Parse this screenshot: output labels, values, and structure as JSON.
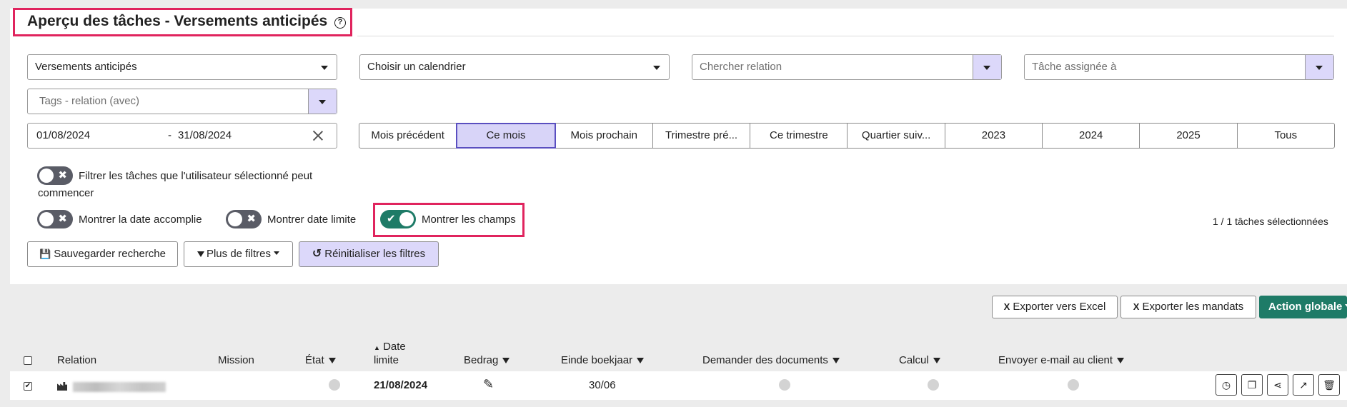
{
  "header": {
    "title": "Aperçu des tâches - Versements anticipés",
    "help_glyph": "?"
  },
  "filters": {
    "type_select": "Versements anticipés",
    "calendar_select": "Choisir un calendrier",
    "relation_search_placeholder": "Chercher relation",
    "assigned_placeholder": "Tâche assignée à",
    "tags_placeholder": "Tags - relation (avec)",
    "date_from": "01/08/2024",
    "date_separator": "-",
    "date_to": "31/08/2024"
  },
  "periods": [
    {
      "label": "Mois précédent",
      "active": false
    },
    {
      "label": "Ce mois",
      "active": true
    },
    {
      "label": "Mois prochain",
      "active": false
    },
    {
      "label": "Trimestre pré...",
      "active": false
    },
    {
      "label": "Ce trimestre",
      "active": false
    },
    {
      "label": "Quartier suiv...",
      "active": false
    },
    {
      "label": "2023",
      "active": false
    },
    {
      "label": "2024",
      "active": false
    },
    {
      "label": "2025",
      "active": false
    },
    {
      "label": "Tous",
      "active": false
    }
  ],
  "toggles": {
    "filter_startable_line1": "Filtrer les tâches que l'utilisateur sélectionné peut",
    "filter_startable_line2": "commencer",
    "show_done_date": "Montrer la date accomplie",
    "show_deadline": "Montrer date limite",
    "show_fields": "Montrer les champs",
    "off_glyph": "✖",
    "on_glyph": "✔"
  },
  "selection_count": "1 / 1 tâches sélectionnées",
  "buttons": {
    "save_search": "Sauvegarder recherche",
    "more_filters": "Plus de filtres",
    "reset_filters": "Réinitialiser les filtres",
    "export_excel": "Exporter vers Excel",
    "export_mandates": "Exporter les mandats",
    "global_action": "Action globale"
  },
  "table": {
    "headers": {
      "relation": "Relation",
      "mission": "Mission",
      "state": "État",
      "deadline_line1": "Date",
      "deadline_line2": "limite",
      "amount": "Bedrag",
      "fiscal_year_end": "Einde boekjaar",
      "request_docs": "Demander des documents",
      "calc": "Calcul",
      "send_email": "Envoyer e-mail au client"
    },
    "rows": [
      {
        "deadline": "21/08/2024",
        "fiscal_year_end": "30/06"
      }
    ]
  },
  "icons": {
    "sort_up": "▲",
    "pencil": "✎",
    "save": "💾",
    "refresh": "↺",
    "history": "◷",
    "copy": "❐",
    "share": "⋖",
    "open": "↗",
    "trash": "🗑",
    "check": "✔",
    "excel": "X"
  },
  "colors": {
    "accent_green": "#1e7b67",
    "highlight_red": "#e0245e",
    "lavender": "#dcd8fa"
  }
}
